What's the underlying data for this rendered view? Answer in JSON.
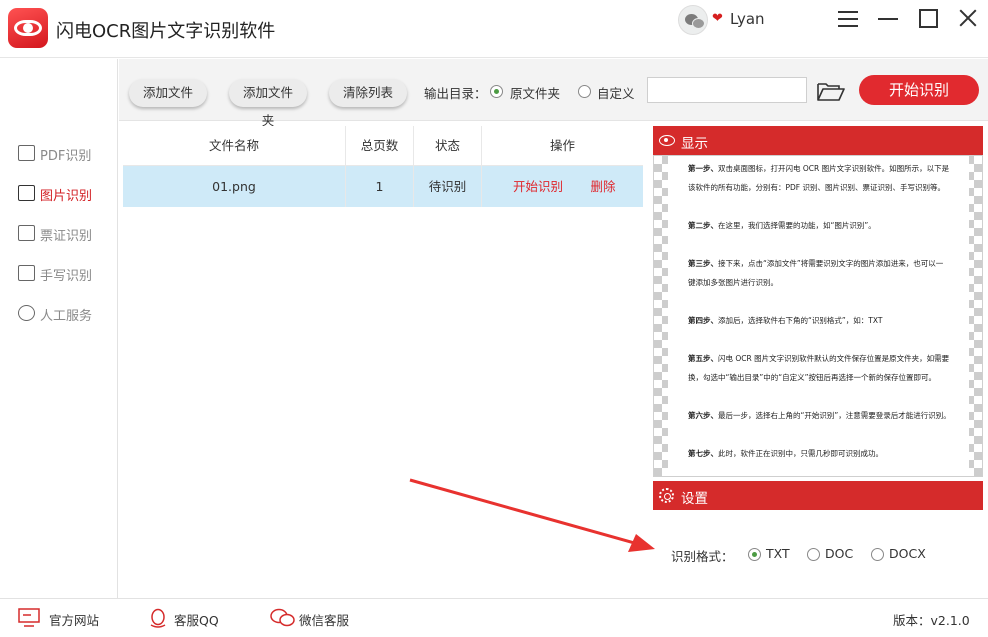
{
  "app": {
    "title": "闪电OCR图片文字识别软件",
    "username": "Lyan"
  },
  "sidebar": {
    "items": [
      {
        "label": "PDF识别",
        "icon": "pdf-icon"
      },
      {
        "label": "图片识别",
        "icon": "image-icon",
        "active": true
      },
      {
        "label": "票证识别",
        "icon": "id-card-icon"
      },
      {
        "label": "手写识别",
        "icon": "handwriting-icon"
      },
      {
        "label": "人工服务",
        "icon": "smile-icon"
      }
    ]
  },
  "toolbar": {
    "add_file": "添加文件",
    "add_folder": "添加文件夹",
    "clear_list": "清除列表",
    "output_label": "输出目录：",
    "output_options": [
      "原文件夹",
      "自定义"
    ],
    "output_selected": "原文件夹",
    "path_value": "",
    "start_label": "开始识别"
  },
  "table": {
    "headers": [
      "文件名称",
      "总页数",
      "状态",
      "操作"
    ],
    "rows": [
      {
        "name": "01.png",
        "pages": "1",
        "status": "待识别",
        "action_start": "开始识别",
        "action_delete": "删除"
      }
    ]
  },
  "preview": {
    "title": "显示",
    "lines": [
      {
        "bold": "第一步、",
        "text": "双击桌面图标，打开闪电 OCR 图片文字识别软件。如图所示，以下是"
      },
      {
        "bold": "",
        "text": "该软件的所有功能，分别有：PDF 识别、图片识别、票证识别、手写识别等。"
      },
      {
        "bold": "第二步、",
        "text": "在这里，我们选择需要的功能，如“图片识别”。"
      },
      {
        "bold": "第三步、",
        "text": "接下来，点击“添加文件”将需要识别文字的图片添加进来，也可以一"
      },
      {
        "bold": "",
        "text": "键添加多张图片进行识别。"
      },
      {
        "bold": "第四步、",
        "text": "添加后，选择软件右下角的“识别格式”，如：TXT"
      },
      {
        "bold": "第五步、",
        "text": "闪电 OCR 图片文字识别软件默认的文件保存位置是原文件夹，如需要"
      },
      {
        "bold": "",
        "text": "换，勾选中“输出目录”中的“自定义”按钮后再选择一个新的保存位置即可。"
      },
      {
        "bold": "第六步、",
        "text": "最后一步，选择右上角的“开始识别”，注意需要登录后才能进行识别。"
      },
      {
        "bold": "第七步、",
        "text": "此时，软件正在识别中，只需几秒即可识别成功。"
      }
    ]
  },
  "settings": {
    "title": "设置",
    "format_label": "识别格式：",
    "formats": [
      "TXT",
      "DOC",
      "DOCX"
    ],
    "format_selected": "TXT"
  },
  "footer": {
    "website": "官方网站",
    "qq": "客服QQ",
    "wechat": "微信客服",
    "version": "版本：v2.1.0"
  },
  "colors": {
    "accent": "#d52b2b",
    "selected_row": "#cfeaf8",
    "radio_on": "#4c9b43"
  }
}
